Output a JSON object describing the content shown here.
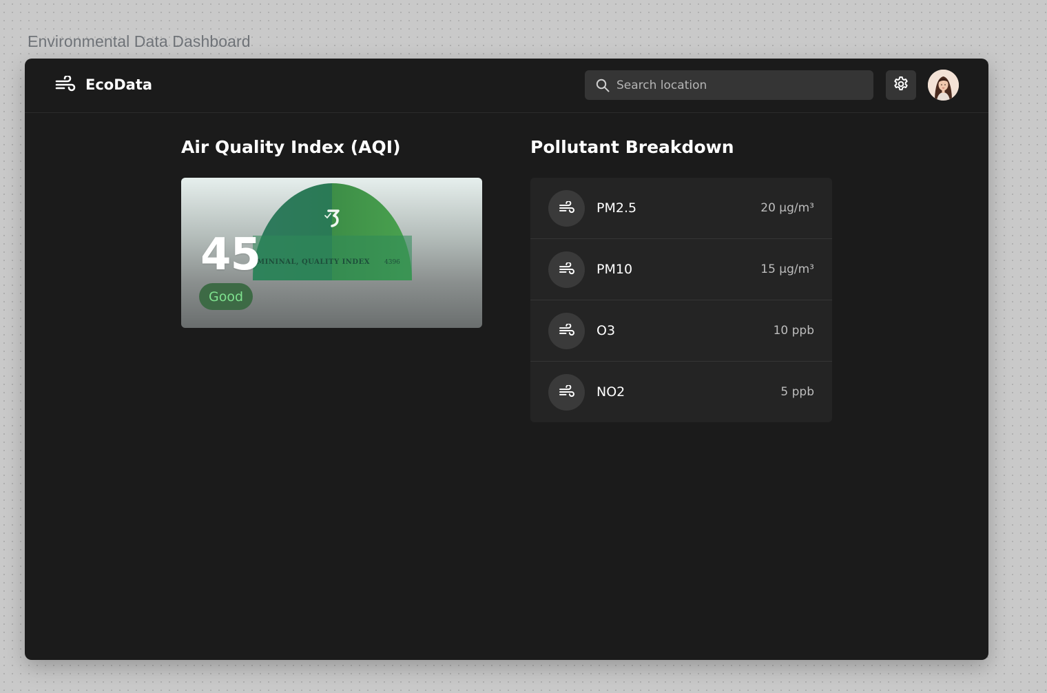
{
  "canvas": {
    "title": "Environmental Data Dashboard"
  },
  "header": {
    "app_name": "EcoData",
    "logo_icon": "wind-icon",
    "search": {
      "placeholder": "Search location",
      "value": "",
      "icon": "search-icon"
    },
    "settings_icon": "gear-icon",
    "avatar_icon": "user-avatar"
  },
  "aqi": {
    "title": "Air Quality Index (AQI)",
    "value": "45",
    "status": "Good",
    "status_color": "#7fe28f",
    "gauge_label": "MININAL, QUALITY INDEX",
    "gauge_number": "4396",
    "accent_color": "#3f9a4a"
  },
  "pollutants": {
    "title": "Pollutant Breakdown",
    "items": [
      {
        "name": "PM2.5",
        "value": "20 µg/m³",
        "icon": "wind-icon"
      },
      {
        "name": "PM10",
        "value": "15 µg/m³",
        "icon": "wind-icon"
      },
      {
        "name": "O3",
        "value": "10 ppb",
        "icon": "wind-icon"
      },
      {
        "name": "NO2",
        "value": "5 ppb",
        "icon": "wind-icon"
      }
    ]
  }
}
